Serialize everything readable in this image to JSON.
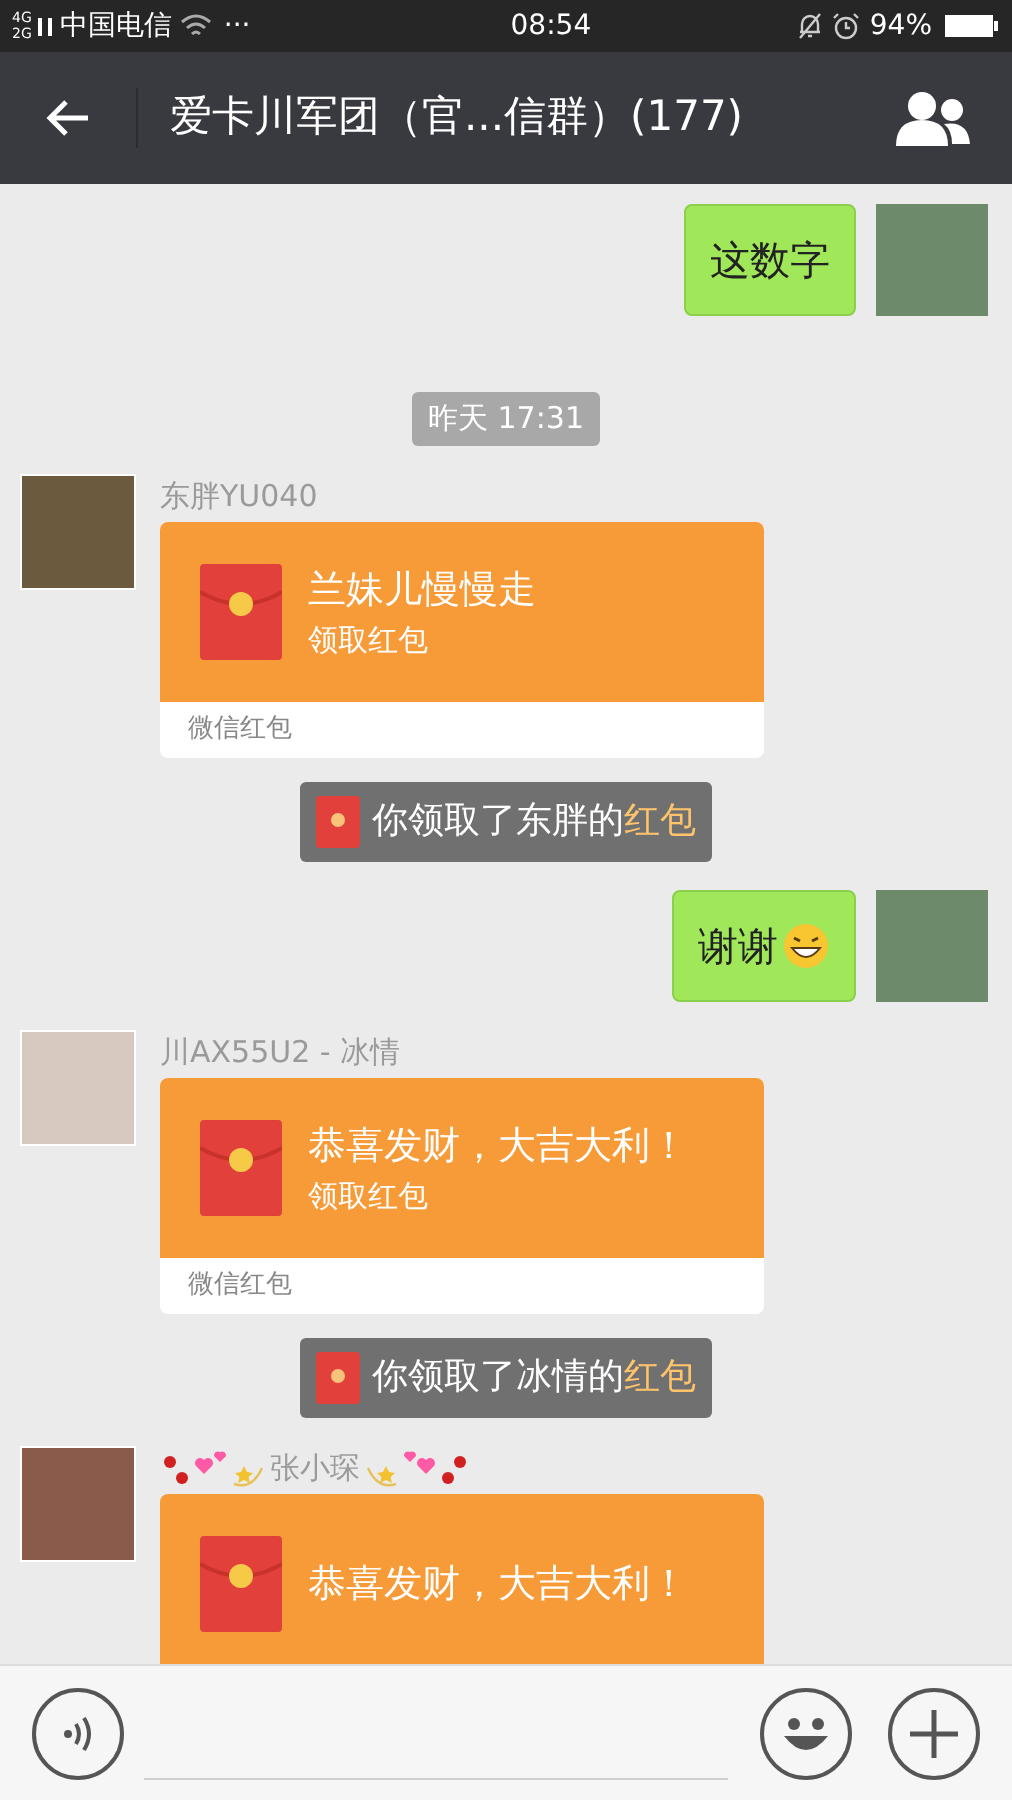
{
  "status_bar": {
    "network": "4G\n2G",
    "carrier": "中国电信",
    "more": "···",
    "time": "08:54",
    "battery": "94%"
  },
  "header": {
    "title": "爱卡川军团（官...信群）(177)"
  },
  "messages": [
    {
      "kind": "outgoing",
      "text": "这数字",
      "emoji": false
    },
    {
      "kind": "time",
      "text": "昨天 17:31"
    },
    {
      "kind": "packet",
      "sender": "东胖YU040",
      "decorated": false,
      "title": "兰妹儿慢慢走",
      "subtitle": "领取红包",
      "footer": "微信红包"
    },
    {
      "kind": "notice",
      "text": "你领取了东胖的",
      "highlight": "红包"
    },
    {
      "kind": "outgoing",
      "text": "谢谢",
      "emoji": true
    },
    {
      "kind": "packet",
      "sender": "川AX55U2 - 冰情",
      "decorated": false,
      "title": "恭喜发财，大吉大利！",
      "subtitle": "领取红包",
      "footer": "微信红包"
    },
    {
      "kind": "notice",
      "text": "你领取了冰情的",
      "highlight": "红包"
    },
    {
      "kind": "packet",
      "sender": "张小琛",
      "decorated": true,
      "title": "恭喜发财，大吉大利！"
    }
  ]
}
